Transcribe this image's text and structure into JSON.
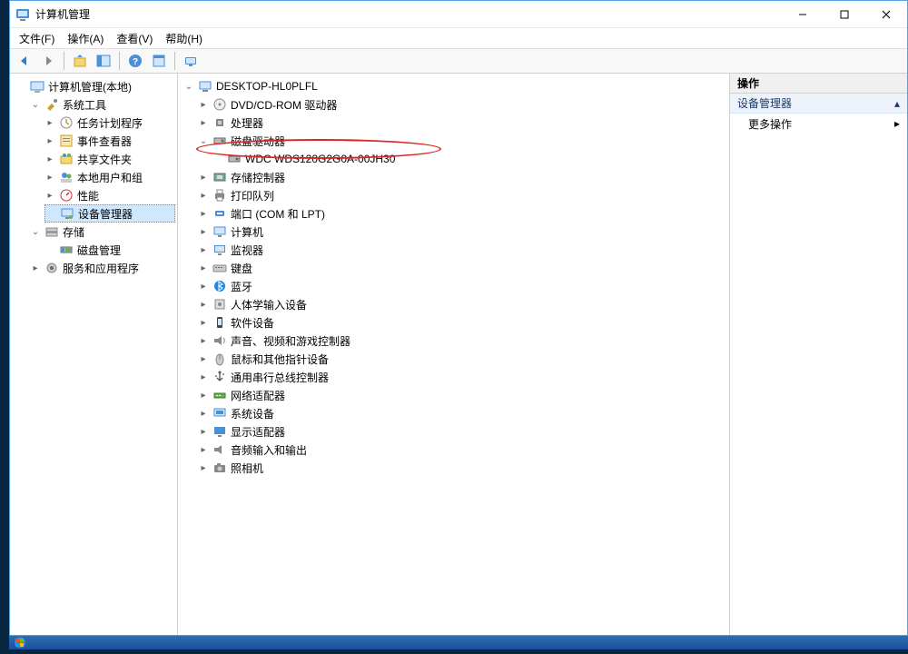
{
  "title": "计算机管理",
  "menu": {
    "file": "文件(F)",
    "action": "操作(A)",
    "view": "查看(V)",
    "help": "帮助(H)"
  },
  "left_tree": {
    "root": "计算机管理(本地)",
    "sys_tools": "系统工具",
    "task_scheduler": "任务计划程序",
    "event_viewer": "事件查看器",
    "shared_folders": "共享文件夹",
    "local_users": "本地用户和组",
    "performance": "性能",
    "device_manager": "设备管理器",
    "storage": "存储",
    "disk_mgmt": "磁盘管理",
    "services_apps": "服务和应用程序"
  },
  "dev_tree": {
    "root": "DESKTOP-HL0PLFL",
    "dvd": "DVD/CD-ROM 驱动器",
    "cpu": "处理器",
    "disk_drives": "磁盘驱动器",
    "disk0": "WDC WDS120G2G0A-00JH30",
    "storage_ctrl": "存储控制器",
    "print_q": "打印队列",
    "ports": "端口 (COM 和 LPT)",
    "computer": "计算机",
    "monitor": "监视器",
    "keyboard": "键盘",
    "bluetooth": "蓝牙",
    "hid": "人体学输入设备",
    "software_dev": "软件设备",
    "sound": "声音、视频和游戏控制器",
    "mouse": "鼠标和其他指针设备",
    "usb": "通用串行总线控制器",
    "network": "网络适配器",
    "system_dev": "系统设备",
    "display": "显示适配器",
    "audio_io": "音频输入和输出",
    "camera": "照相机"
  },
  "actions_pane": {
    "header": "操作",
    "section": "设备管理器",
    "more": "更多操作"
  }
}
